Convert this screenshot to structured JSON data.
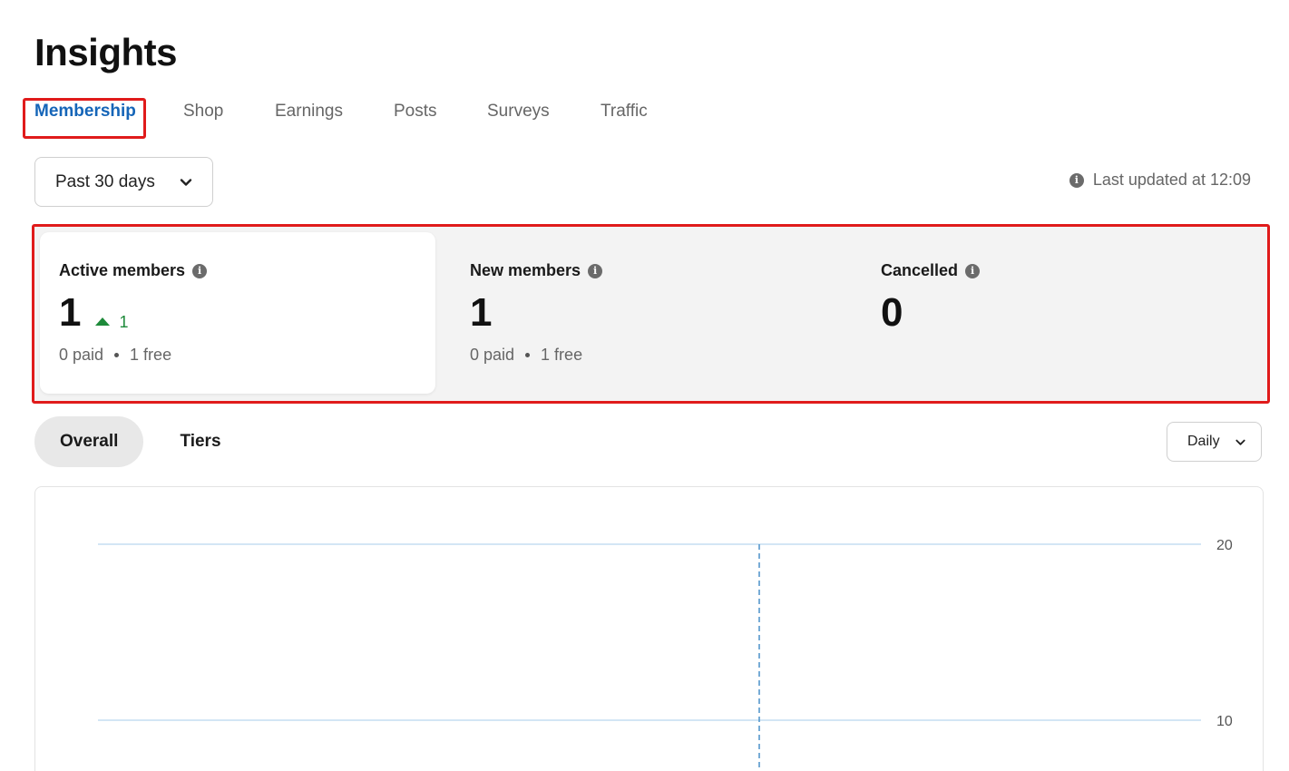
{
  "page": {
    "title": "Insights"
  },
  "tabs": [
    {
      "label": "Membership",
      "active": true
    },
    {
      "label": "Shop"
    },
    {
      "label": "Earnings"
    },
    {
      "label": "Posts"
    },
    {
      "label": "Surveys"
    },
    {
      "label": "Traffic"
    }
  ],
  "filters": {
    "range": {
      "value": "Past 30 days",
      "icon": "chevron-down-icon"
    },
    "last_updated": "Last updated at 12:09"
  },
  "stats": {
    "active": {
      "label": "Active members",
      "value": "1",
      "delta": "1",
      "paid": "0 paid",
      "free": "1 free"
    },
    "new": {
      "label": "New members",
      "value": "1",
      "paid": "0 paid",
      "free": "1 free"
    },
    "cancelled": {
      "label": "Cancelled",
      "value": "0"
    }
  },
  "view_toggle": {
    "overall": "Overall",
    "tiers": "Tiers",
    "selected": "Overall"
  },
  "interval": {
    "value": "Daily"
  },
  "chart_data": {
    "type": "line",
    "y_ticks": [
      "20",
      "10"
    ],
    "grid": true,
    "colors": {
      "grid": "#b9d7ef",
      "marker": "#4a90c8"
    }
  }
}
